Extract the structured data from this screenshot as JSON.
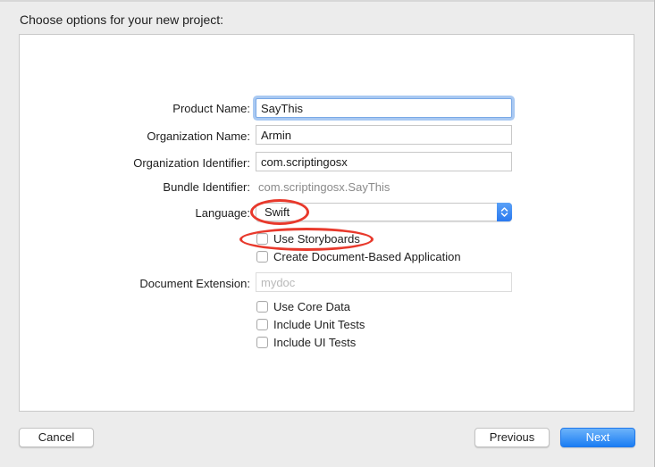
{
  "header": {
    "title": "Choose options for your new project:"
  },
  "form": {
    "product_name": {
      "label": "Product Name:",
      "value": "SayThis"
    },
    "organization_name": {
      "label": "Organization Name:",
      "value": "Armin"
    },
    "organization_identifier": {
      "label": "Organization Identifier:",
      "value": "com.scriptingosx"
    },
    "bundle_identifier": {
      "label": "Bundle Identifier:",
      "value": "com.scriptingosx.SayThis"
    },
    "language": {
      "label": "Language:",
      "value": "Swift"
    },
    "use_storyboards": {
      "label": "Use Storyboards",
      "checked": false
    },
    "document_based": {
      "label": "Create Document-Based Application",
      "checked": false
    },
    "document_extension": {
      "label": "Document Extension:",
      "placeholder": "mydoc"
    },
    "core_data": {
      "label": "Use Core Data",
      "checked": false
    },
    "unit_tests": {
      "label": "Include Unit Tests",
      "checked": false
    },
    "ui_tests": {
      "label": "Include UI Tests",
      "checked": false
    }
  },
  "footer": {
    "cancel_label": "Cancel",
    "previous_label": "Previous",
    "next_label": "Next"
  },
  "colors": {
    "accent": "#2a79ef",
    "annotation": "#e8392c"
  },
  "icons": {
    "language_popup": "chevron-up-down-icon"
  }
}
